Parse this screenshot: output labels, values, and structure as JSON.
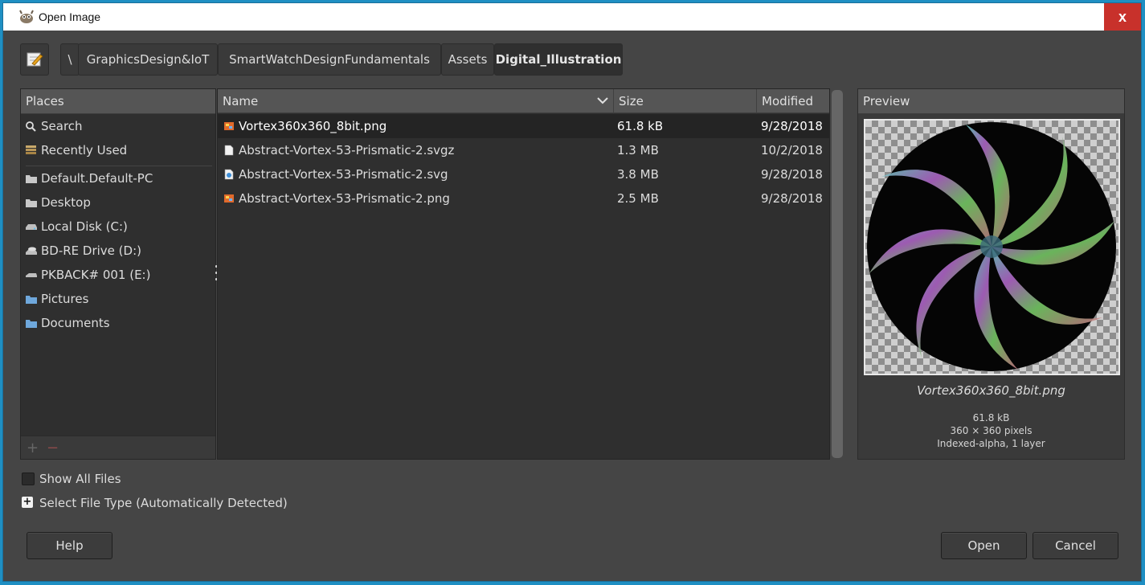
{
  "window": {
    "title": "Open Image",
    "close_label": "x"
  },
  "breadcrumb": {
    "root": "\\",
    "items": [
      "GraphicsDesign&IoT",
      "SmartWatchDesignFundamentals",
      "Assets",
      "Digital_Illustration"
    ],
    "active_index": 3
  },
  "places": {
    "header": "Places",
    "items": [
      {
        "label": "Search",
        "icon": "search-icon"
      },
      {
        "label": "Recently Used",
        "icon": "recent-icon"
      },
      {
        "label": "Default.Default-PC",
        "icon": "folder-icon"
      },
      {
        "label": "Desktop",
        "icon": "folder-icon"
      },
      {
        "label": "Local Disk (C:)",
        "icon": "drive-icon"
      },
      {
        "label": "BD-RE Drive (D:)",
        "icon": "optical-drive-icon"
      },
      {
        "label": "PKBACK# 001 (E:)",
        "icon": "drive-icon"
      },
      {
        "label": "Pictures",
        "icon": "folder-blue-icon"
      },
      {
        "label": "Documents",
        "icon": "folder-blue-icon"
      }
    ],
    "add_label": "+",
    "remove_label": "−"
  },
  "files": {
    "columns": {
      "name": "Name",
      "size": "Size",
      "modified": "Modified"
    },
    "rows": [
      {
        "name": "Vortex360x360_8bit.png",
        "size": "61.8 kB",
        "modified": "9/28/2018",
        "icon": "image-file-icon",
        "selected": true
      },
      {
        "name": "Abstract-Vortex-53-Prismatic-2.svgz",
        "size": "1.3 MB",
        "modified": "10/2/2018",
        "icon": "blank-file-icon",
        "selected": false
      },
      {
        "name": "Abstract-Vortex-53-Prismatic-2.svg",
        "size": "3.8 MB",
        "modified": "9/28/2018",
        "icon": "svg-file-icon",
        "selected": false
      },
      {
        "name": "Abstract-Vortex-53-Prismatic-2.png",
        "size": "2.5 MB",
        "modified": "9/28/2018",
        "icon": "image-file-icon",
        "selected": false
      }
    ]
  },
  "preview": {
    "header": "Preview",
    "filename": "Vortex360x360_8bit.png",
    "size": "61.8 kB",
    "dimensions": "360 × 360 pixels",
    "mode": "Indexed-alpha, 1 layer"
  },
  "options": {
    "show_all_files": "Show All Files",
    "select_file_type": "Select File Type (Automatically Detected)"
  },
  "buttons": {
    "help": "Help",
    "open": "Open",
    "cancel": "Cancel"
  }
}
